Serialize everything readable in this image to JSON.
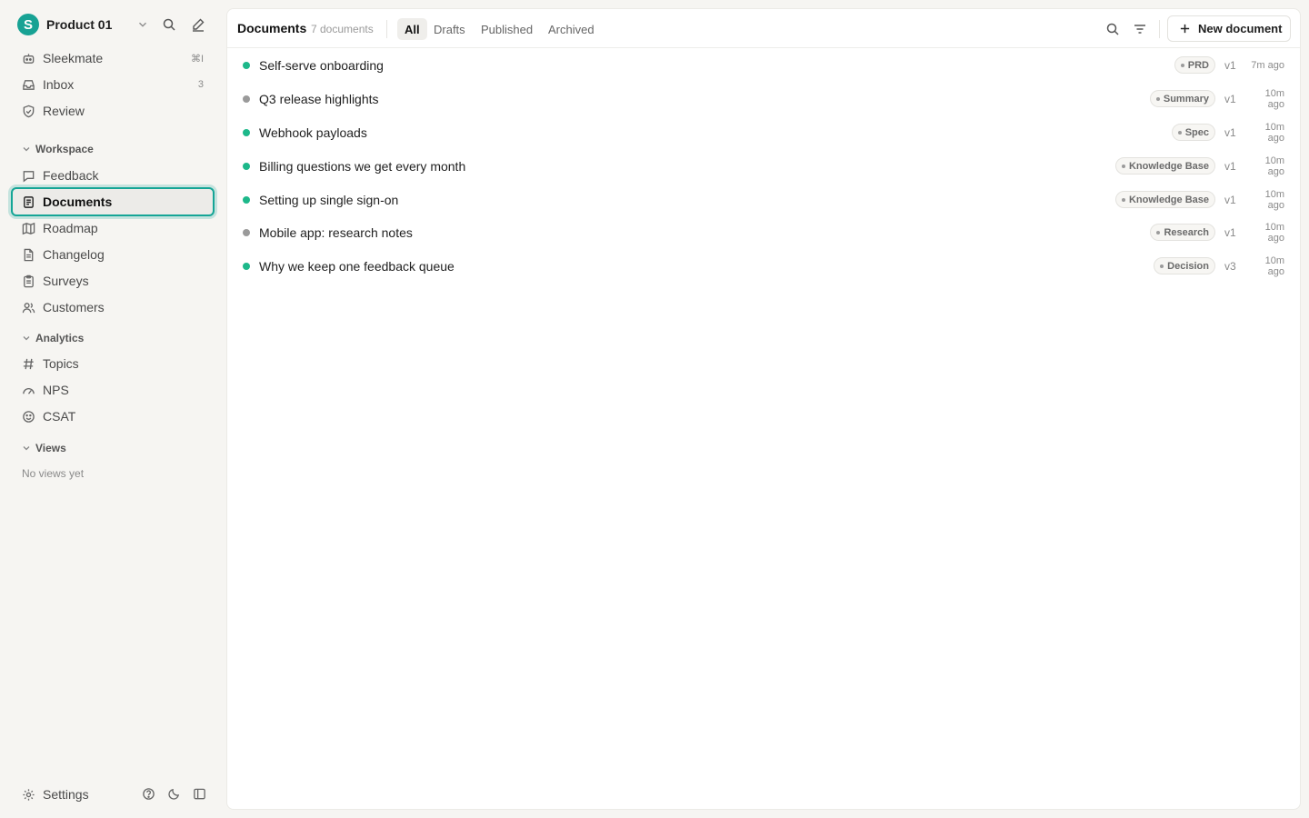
{
  "workspace": {
    "logo_letter": "S",
    "name": "Product 01"
  },
  "nav_top": [
    {
      "label": "Sleekmate",
      "meta": "⌘I",
      "icon": "bot-icon"
    },
    {
      "label": "Inbox",
      "meta": "3",
      "icon": "inbox-icon"
    },
    {
      "label": "Review",
      "meta": "",
      "icon": "shield-check-icon"
    }
  ],
  "sections": {
    "workspace": "Workspace",
    "analytics": "Analytics",
    "views": "Views"
  },
  "nav_workspace": [
    {
      "label": "Feedback",
      "icon": "message-square-icon"
    },
    {
      "label": "Documents",
      "icon": "document-icon",
      "active": true
    },
    {
      "label": "Roadmap",
      "icon": "map-icon"
    },
    {
      "label": "Changelog",
      "icon": "file-text-icon"
    },
    {
      "label": "Surveys",
      "icon": "clipboard-icon"
    },
    {
      "label": "Customers",
      "icon": "users-icon"
    }
  ],
  "nav_analytics": [
    {
      "label": "Topics",
      "icon": "hash-icon"
    },
    {
      "label": "NPS",
      "icon": "gauge-icon"
    },
    {
      "label": "CSAT",
      "icon": "smile-icon"
    }
  ],
  "views_empty": "No views yet",
  "footer": {
    "settings_label": "Settings"
  },
  "header": {
    "title": "Documents",
    "count": "7 documents",
    "tabs": [
      "All",
      "Drafts",
      "Published",
      "Archived"
    ],
    "active_tab": "All",
    "new_button": "New document"
  },
  "colors": {
    "accent": "#15a596",
    "published": "#1db88a",
    "draft": "#9a9a9a"
  },
  "documents": [
    {
      "title": "Self-serve onboarding",
      "tag": "PRD",
      "version": "v1",
      "updated": "7m ago",
      "status": "published"
    },
    {
      "title": "Q3 release highlights",
      "tag": "Summary",
      "version": "v1",
      "updated": "10m ago",
      "status": "draft"
    },
    {
      "title": "Webhook payloads",
      "tag": "Spec",
      "version": "v1",
      "updated": "10m ago",
      "status": "published"
    },
    {
      "title": "Billing questions we get every month",
      "tag": "Knowledge Base",
      "version": "v1",
      "updated": "10m ago",
      "status": "published"
    },
    {
      "title": "Setting up single sign-on",
      "tag": "Knowledge Base",
      "version": "v1",
      "updated": "10m ago",
      "status": "published"
    },
    {
      "title": "Mobile app: research notes",
      "tag": "Research",
      "version": "v1",
      "updated": "10m ago",
      "status": "draft"
    },
    {
      "title": "Why we keep one feedback queue",
      "tag": "Decision",
      "version": "v3",
      "updated": "10m ago",
      "status": "published"
    }
  ]
}
